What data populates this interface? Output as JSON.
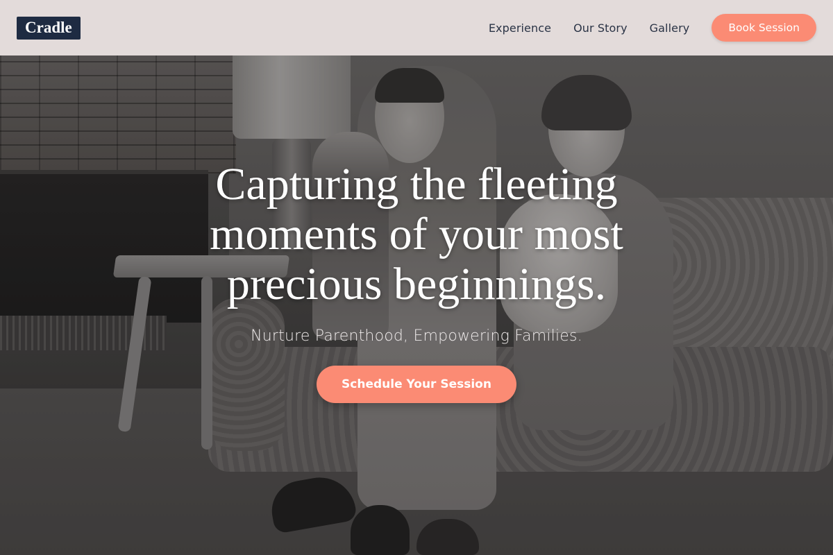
{
  "header": {
    "logo": "Cradle",
    "nav": [
      {
        "label": "Experience"
      },
      {
        "label": "Our Story"
      },
      {
        "label": "Gallery"
      }
    ],
    "cta_label": "Book Session"
  },
  "hero": {
    "headline": "Capturing the fleeting moments of your most precious beginnings.",
    "subheadline": "Nurture Parenthood, Empowering Families.",
    "cta_label": "Schedule Your Session",
    "background_image": "vintage-family-photo"
  },
  "colors": {
    "accent": "#fb8b74",
    "logo_bg": "#1e2b42",
    "nav_text": "#2a3345",
    "header_bg": "#e8e0df"
  }
}
